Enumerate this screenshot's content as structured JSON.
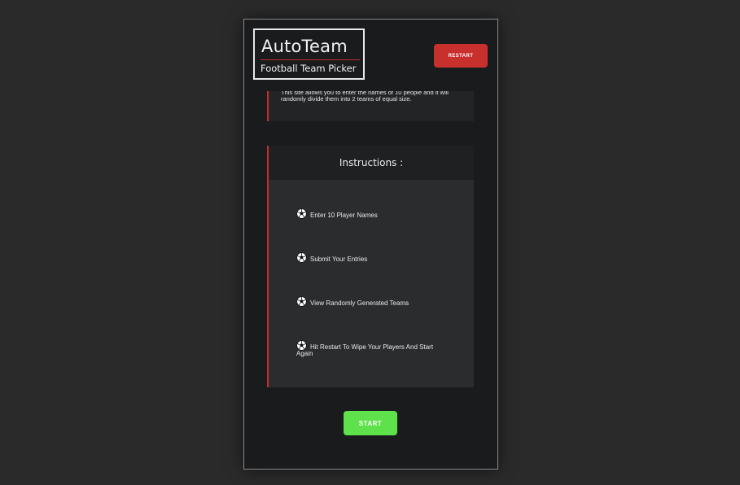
{
  "header": {
    "logo_title": "AutoTeam",
    "logo_subtitle": "Football Team Picker",
    "restart_label": "RESTART"
  },
  "intro": {
    "text": "This site allows you to enter the names of 10 people and it will randomly divide them into 2 teams of equal size."
  },
  "instructions": {
    "title": "Instructions :",
    "steps": [
      "Enter 10 Player Names",
      "Submit Your Entries",
      "View Randomly Generated Teams",
      "Hit Restart To Wipe Your Players And Start Again"
    ]
  },
  "start_label": "START",
  "colors": {
    "accent_red": "#c8302d",
    "start_green": "#5ee14b",
    "panel_dark": "#1a1b1c",
    "card": "#2b2c2e"
  }
}
